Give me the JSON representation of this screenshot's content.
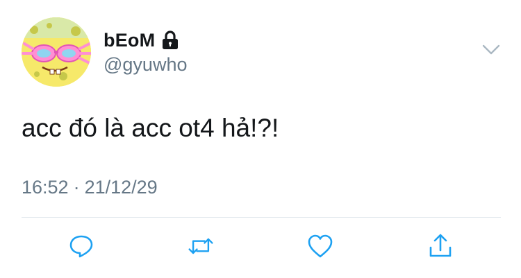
{
  "tweet": {
    "user": {
      "display_name": "bEoM",
      "handle": "@gyuwho",
      "protected": true,
      "avatar": "spongebob-with-pink-sunglasses"
    },
    "text": "acc đó là acc ot4 hả!?!",
    "time": "16:52",
    "separator": "·",
    "date": "21/12/29"
  },
  "icons": {
    "lock": "lock-icon",
    "caret": "chevron-down-icon",
    "reply": "reply-icon",
    "retweet": "retweet-icon",
    "like": "heart-icon",
    "share": "share-icon"
  },
  "colors": {
    "text": "#14171a",
    "secondary": "#657786",
    "divider": "#e1e8ed",
    "icon": "#1da1f2"
  }
}
